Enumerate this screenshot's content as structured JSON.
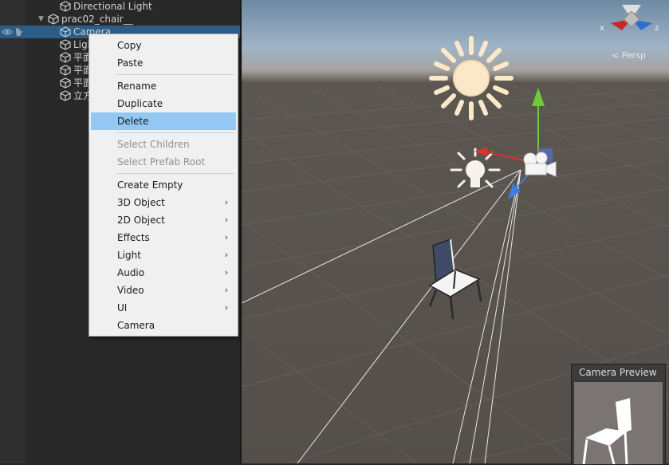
{
  "hierarchy": {
    "items": [
      {
        "label": "Directional Light",
        "indent": 2,
        "selected": false
      },
      {
        "label": "prac02_chair__",
        "indent": 1,
        "expanded": true,
        "selected": false
      },
      {
        "label": "Camera",
        "indent": 2,
        "selected": true
      },
      {
        "label": "Ligh",
        "indent": 2,
        "selected": false
      },
      {
        "label": "平面",
        "indent": 2,
        "selected": false
      },
      {
        "label": "平面",
        "indent": 2,
        "selected": false
      },
      {
        "label": "平面",
        "indent": 2,
        "selected": false
      },
      {
        "label": "立方",
        "indent": 2,
        "selected": false
      }
    ]
  },
  "context_menu": {
    "items": [
      {
        "label": "Copy",
        "disabled": false
      },
      {
        "label": "Paste",
        "disabled": false
      },
      {
        "separator": true
      },
      {
        "label": "Rename",
        "disabled": false
      },
      {
        "label": "Duplicate",
        "disabled": false
      },
      {
        "label": "Delete",
        "disabled": false,
        "highlighted": true
      },
      {
        "separator": true
      },
      {
        "label": "Select Children",
        "disabled": true
      },
      {
        "label": "Select Prefab Root",
        "disabled": true
      },
      {
        "separator": true
      },
      {
        "label": "Create Empty",
        "disabled": false
      },
      {
        "label": "3D Object",
        "submenu": true
      },
      {
        "label": "2D Object",
        "submenu": true
      },
      {
        "label": "Effects",
        "submenu": true
      },
      {
        "label": "Light",
        "submenu": true
      },
      {
        "label": "Audio",
        "submenu": true
      },
      {
        "label": "Video",
        "submenu": true
      },
      {
        "label": "UI",
        "submenu": true
      },
      {
        "label": "Camera",
        "disabled": false
      }
    ]
  },
  "scene": {
    "projection_label": "< Persp",
    "gizmo_axes": {
      "x": "x",
      "z": "z"
    }
  },
  "camera_preview": {
    "title": "Camera Preview"
  },
  "colors": {
    "selection": "#2c5d87",
    "menu_highlight": "#92c8f3",
    "axis_x": "#d8332c",
    "axis_y": "#6ec93d",
    "axis_z": "#3d7fe0"
  },
  "icons": {
    "hierarchy_item": "gameobject-cube-icon",
    "visibility": "eye-icon",
    "pickability": "hand-icon",
    "sun": "directional-light-sun-icon",
    "point_light": "light-bulb-icon",
    "camera": "camera-icon",
    "submenu": "chevron-right-icon"
  }
}
